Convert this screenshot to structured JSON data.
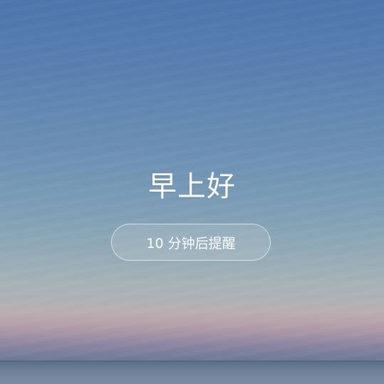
{
  "alarm": {
    "greeting": "早上好",
    "snooze_label": "10 分钟后提醒"
  }
}
